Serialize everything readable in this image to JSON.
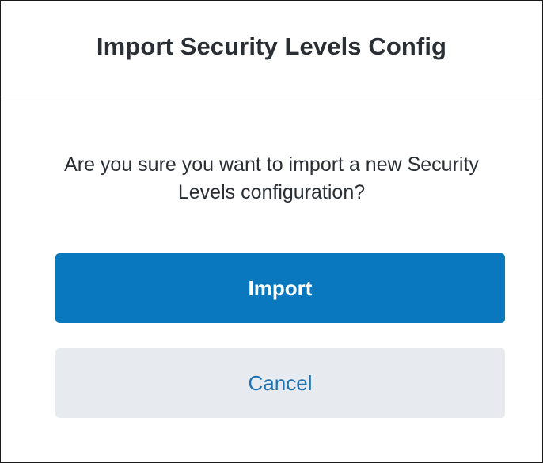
{
  "dialog": {
    "title": "Import Security Levels Config",
    "message": "Are you sure you want to import a new Security Levels configuration?",
    "buttons": {
      "import_label": "Import",
      "cancel_label": "Cancel"
    }
  },
  "colors": {
    "primary": "#0a78be",
    "secondary_background": "#e7ebf0",
    "secondary_text": "#1d73b3",
    "text": "#2a2f35"
  }
}
